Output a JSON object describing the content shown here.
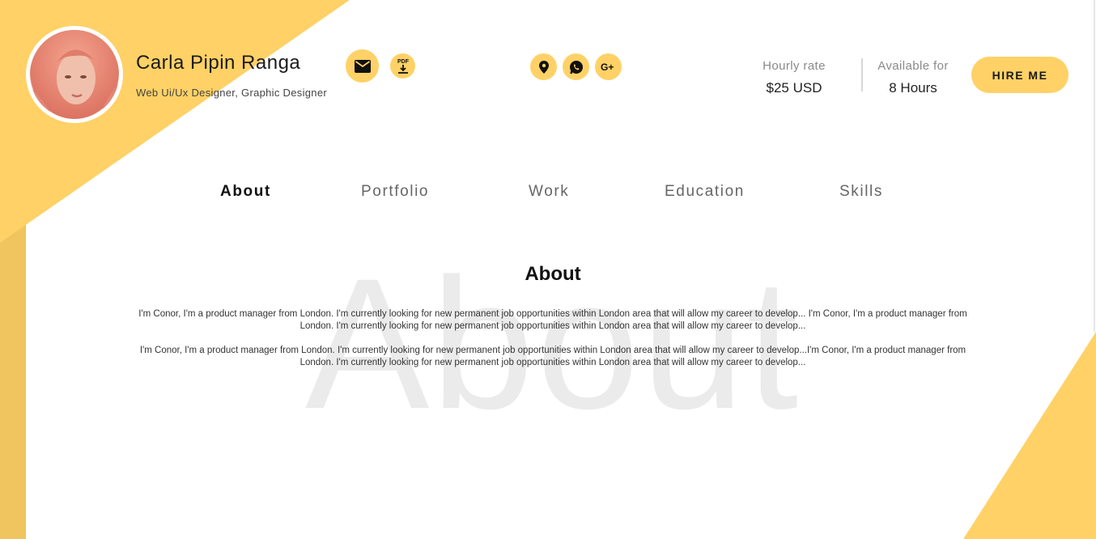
{
  "profile": {
    "name": "Carla Pipin Ranga",
    "role": "Web Ui/Ux Designer, Graphic Designer"
  },
  "contact_icons": [
    "mail-icon",
    "pdf-download-icon",
    "location-pin-icon",
    "whatsapp-icon",
    "google-plus-icon"
  ],
  "pdf_label": "PDF",
  "stats": {
    "rate_label": "Hourly rate",
    "rate_value": "$25 USD",
    "avail_label": "Available for",
    "avail_value": "8 Hours"
  },
  "hire_label": "HIRE ME",
  "nav": [
    "About",
    "Portfolio",
    "Work",
    "Education",
    "Skills"
  ],
  "active_tab": "About",
  "about": {
    "watermark": "About",
    "title": "About",
    "paragraphs": [
      "I'm Conor, I'm a product manager from London. I'm currently looking for new permanent job opportunities within London area that will allow my career to develop... I'm Conor, I'm a product manager from London. I'm currently looking for new permanent job opportunities within London area that will allow my career to develop...",
      "I'm Conor, I'm a product manager from London. I'm currently looking for new permanent job opportunities within London area that will allow my career to develop...I'm Conor, I'm a product manager from London. I'm currently looking for new permanent job opportunities within London area that will allow my career to develop..."
    ]
  },
  "colors": {
    "accent": "#ffd166",
    "accent_dark": "#f0c45f",
    "text": "#222222",
    "muted": "#8a8a8a",
    "watermark": "#ebebeb"
  }
}
